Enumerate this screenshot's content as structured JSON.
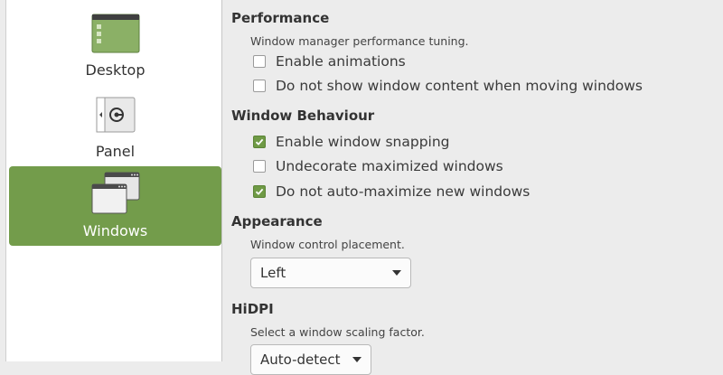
{
  "sidebar": {
    "items": [
      {
        "label": "Desktop",
        "icon": "desktop-icon"
      },
      {
        "label": "Panel",
        "icon": "panel-icon"
      },
      {
        "label": "Windows",
        "icon": "windows-icon"
      }
    ],
    "selected": "Windows",
    "accent": "#739c4b"
  },
  "sections": {
    "performance": {
      "title": "Performance",
      "description": "Window manager performance tuning.",
      "options": [
        {
          "label": "Enable animations",
          "checked": false
        },
        {
          "label": "Do not show window content when moving windows",
          "checked": false
        }
      ]
    },
    "window_behaviour": {
      "title": "Window Behaviour",
      "options": [
        {
          "label": "Enable window snapping",
          "checked": true
        },
        {
          "label": "Undecorate maximized windows",
          "checked": false
        },
        {
          "label": "Do not auto-maximize new windows",
          "checked": true
        }
      ]
    },
    "appearance": {
      "title": "Appearance",
      "description": "Window control placement.",
      "placement_value": "Left"
    },
    "hidpi": {
      "title": "HiDPI",
      "description": "Select a window scaling factor.",
      "scaling_value": "Auto-detect"
    }
  }
}
